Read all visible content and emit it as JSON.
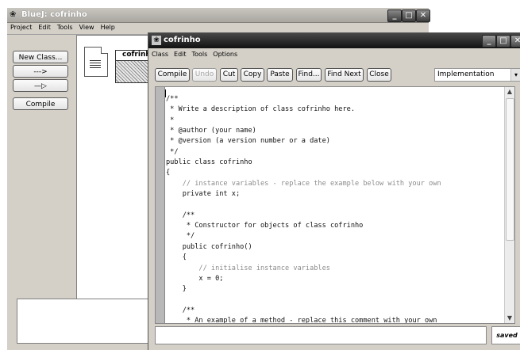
{
  "main_window": {
    "title": "BlueJ:  cofrinho",
    "icon": "bluej-logo-icon",
    "controls": {
      "minimize": "_",
      "maximize": "□",
      "close": "✕"
    },
    "menu": [
      "Project",
      "Edit",
      "Tools",
      "View",
      "Help"
    ],
    "tools": {
      "new_class": "New Class...",
      "uses_arrow": "--->",
      "inherits_arrow": "—▷",
      "compile": "Compile"
    },
    "class_diagram": {
      "class_name": "cofrinh",
      "readme_icon": "document-icon"
    }
  },
  "editor_window": {
    "title": "cofrinho",
    "controls": {
      "minimize": "_",
      "maximize": "□",
      "close": "✕"
    },
    "menu": [
      "Class",
      "Edit",
      "Tools",
      "Options"
    ],
    "toolbar": {
      "compile": "Compile",
      "undo": "Undo",
      "cut": "Cut",
      "copy": "Copy",
      "paste": "Paste",
      "find": "Find...",
      "find_next": "Find Next",
      "close": "Close"
    },
    "view_select": {
      "value": "Implementation",
      "arrow": "▾"
    },
    "code_lines": [
      {
        "text": "/**",
        "comment": false
      },
      {
        "text": " * Write a description of class cofrinho here.",
        "comment": false
      },
      {
        "text": " *",
        "comment": false
      },
      {
        "text": " * @author (your name)",
        "comment": false
      },
      {
        "text": " * @version (a version number or a date)",
        "comment": false
      },
      {
        "text": " */",
        "comment": false
      },
      {
        "text": "public class cofrinho",
        "comment": false
      },
      {
        "text": "{",
        "comment": false
      },
      {
        "text": "    // instance variables - replace the example below with your own",
        "comment": true
      },
      {
        "text": "    private int x;",
        "comment": false
      },
      {
        "text": "",
        "comment": false
      },
      {
        "text": "    /**",
        "comment": false
      },
      {
        "text": "     * Constructor for objects of class cofrinho",
        "comment": false
      },
      {
        "text": "     */",
        "comment": false
      },
      {
        "text": "    public cofrinho()",
        "comment": false
      },
      {
        "text": "    {",
        "comment": false
      },
      {
        "text": "        // initialise instance variables",
        "comment": true
      },
      {
        "text": "        x = 0;",
        "comment": false
      },
      {
        "text": "    }",
        "comment": false
      },
      {
        "text": "",
        "comment": false
      },
      {
        "text": "    /**",
        "comment": false
      },
      {
        "text": "     * An example of a method - replace this comment with your own",
        "comment": false
      }
    ],
    "status": {
      "message": "",
      "saved": "saved"
    }
  }
}
